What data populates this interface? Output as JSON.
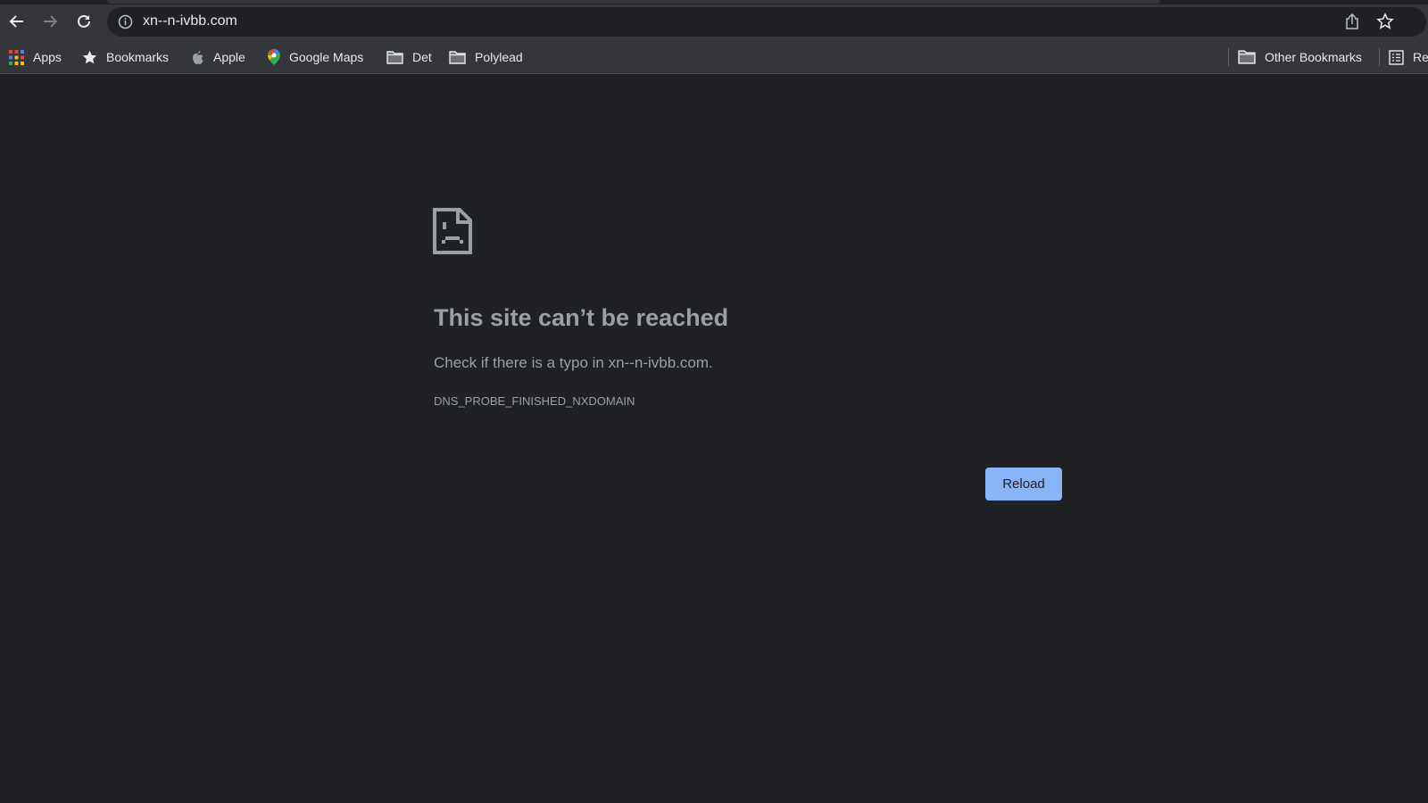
{
  "browser": {
    "url": "xn--n-ivbb.com",
    "bookmarks": [
      {
        "label": "Apps",
        "icon": "apps-grid-icon"
      },
      {
        "label": "Bookmarks",
        "icon": "star-icon"
      },
      {
        "label": "Apple",
        "icon": "apple-icon"
      },
      {
        "label": "Google Maps",
        "icon": "maps-pin-icon"
      },
      {
        "label": "Det",
        "icon": "folder-icon"
      },
      {
        "label": "Polylead",
        "icon": "folder-icon"
      }
    ],
    "other_bookmarks": "Other Bookmarks",
    "reading_list": "Re"
  },
  "error": {
    "title": "This site can’t be reached",
    "message": "Check if there is a typo in xn--n-ivbb.com.",
    "code": "DNS_PROBE_FINISHED_NXDOMAIN",
    "reload_label": "Reload"
  },
  "colors": {
    "accent": "#8ab4f8",
    "background": "#202124",
    "toolbar": "#35363a"
  }
}
